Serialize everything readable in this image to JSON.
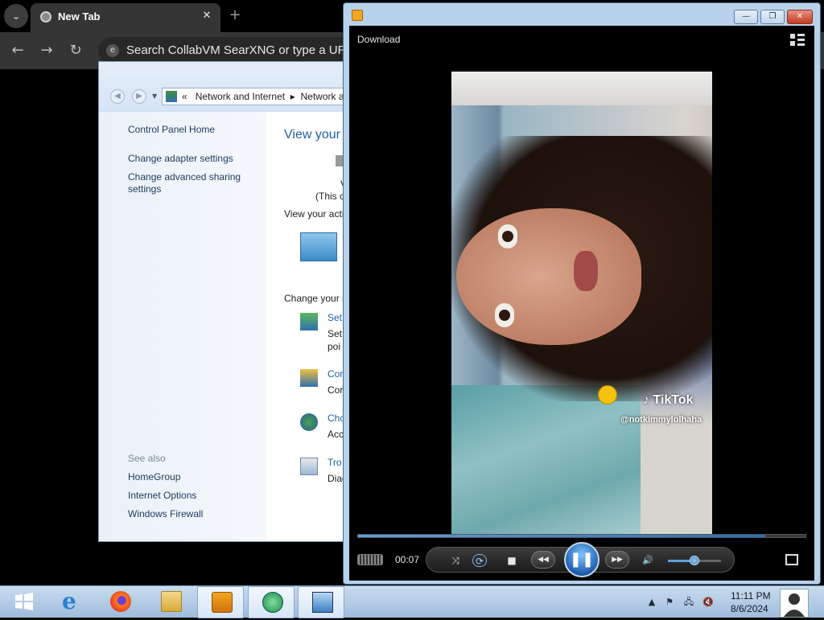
{
  "browser": {
    "tab_title": "New Tab",
    "tab_close": "✕",
    "new_tab": "+",
    "address_text": "Search CollabVM SearXNG or type a URL",
    "back": "←",
    "forward": "→",
    "reload": "↻"
  },
  "control_panel": {
    "breadcrumb_sep": "«",
    "breadcrumb_1": "Network and Internet",
    "breadcrumb_arrow": "▸",
    "breadcrumb_2": "Network a",
    "left_links": [
      "Control Panel Home",
      "Change adapter settings",
      "Change advanced sharing",
      "settings"
    ],
    "see_also": "See also",
    "see_also_links": [
      "HomeGroup",
      "Internet Options",
      "Windows Firewall"
    ],
    "main_title": "View your",
    "main_texts": [
      "V",
      "(This c",
      "View your acti",
      "Change your n"
    ],
    "tasks": [
      {
        "link": "Set",
        "desc1": "Set",
        "desc2": "poi"
      },
      {
        "link": "Cor",
        "desc1": "Cor",
        "desc2": ""
      },
      {
        "link": "Cho",
        "desc1": "Acc",
        "desc2": ""
      },
      {
        "link": "Tro",
        "desc1": "Diag",
        "desc2": ""
      }
    ]
  },
  "media_player": {
    "download_label": "Download",
    "elapsed": "00:07",
    "progress": 0.91,
    "volume": 0.5,
    "tiktok_logo": "TikTok",
    "tiktok_handle": "@notkimmylolhaha",
    "window_buttons": {
      "minimize": "—",
      "maximize": "❐",
      "close": "✕"
    },
    "controls": {
      "shuffle": "⤨",
      "repeat": "⟳",
      "stop": "■",
      "prev": "◀◀",
      "play_pause": "❚❚",
      "next": "▶▶",
      "volume": "🔊"
    }
  },
  "taskbar": {
    "items": [
      {
        "name": "start-button",
        "icon": "windows-logo"
      },
      {
        "name": "internet-explorer",
        "icon": "ie-icon"
      },
      {
        "name": "firefox",
        "icon": "firefox-icon"
      },
      {
        "name": "file-explorer",
        "icon": "folder-icon"
      },
      {
        "name": "media-player",
        "icon": "wmp-icon"
      },
      {
        "name": "media-center",
        "icon": "media-center-icon"
      },
      {
        "name": "control-panel",
        "icon": "network-icon"
      }
    ],
    "clock_time": "11:11 PM",
    "clock_date": "8/6/2024"
  }
}
